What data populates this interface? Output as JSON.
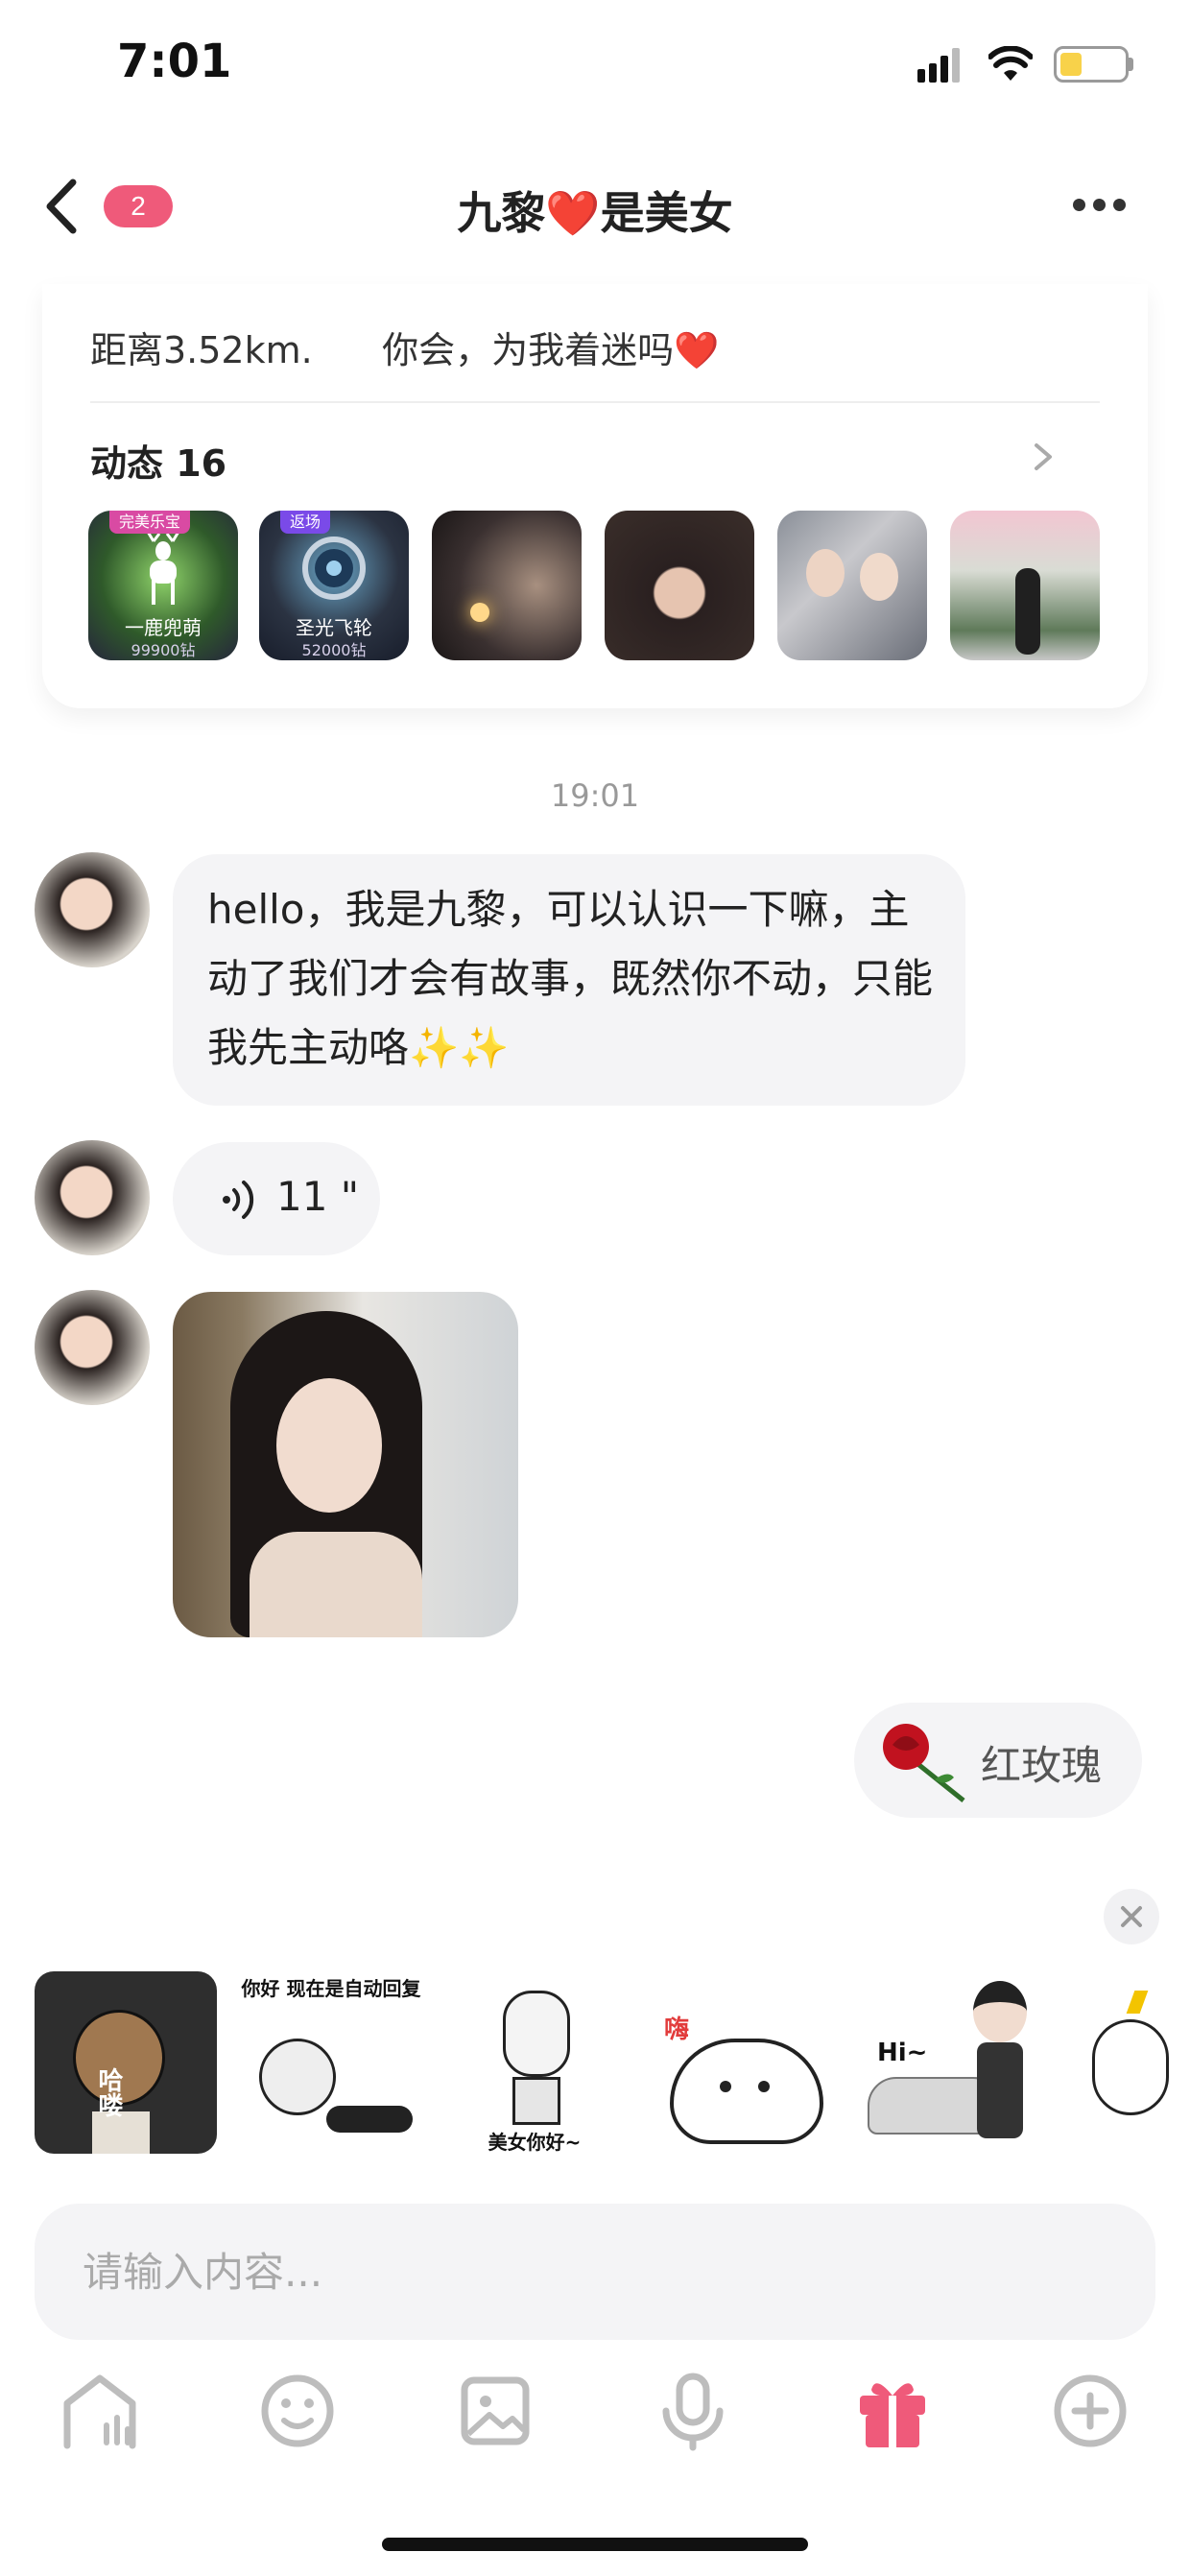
{
  "status_bar": {
    "time": "7:01"
  },
  "nav": {
    "badge": "2",
    "title": "九黎❤️是美女"
  },
  "profile": {
    "distance_line": "距离3.52km.      你会，为我着迷吗❤️",
    "moments_title": "动态 16",
    "thumbs": [
      {
        "tag": "完美乐宝",
        "name": "一鹿兜萌",
        "price": "99900钻"
      },
      {
        "tag": "返场",
        "name": "圣光飞轮",
        "price": "52000钻"
      }
    ]
  },
  "chat": {
    "time": "19:01",
    "messages": [
      {
        "type": "text",
        "text": "hello，我是九黎，可以认识一下嘛，主动了我们才会有故事，既然你不动，只能我先主动咯✨✨"
      },
      {
        "type": "voice",
        "duration": "11 \""
      },
      {
        "type": "image"
      }
    ],
    "gift": {
      "label": "红玫瑰"
    }
  },
  "stickers": [
    {
      "text": "哈喽"
    },
    {
      "text": "你好 现在是自动回复"
    },
    {
      "text": "美女你好~"
    },
    {
      "text": "嗨"
    },
    {
      "text": "Hi~"
    },
    {
      "text": ""
    }
  ],
  "input": {
    "placeholder": "请输入内容..."
  },
  "toolbar": [
    "home-icon",
    "emoji-icon",
    "image-icon",
    "mic-icon",
    "gift-icon",
    "plus-icon"
  ],
  "colors": {
    "accent": "#ef5a7a",
    "bubble": "#f4f4f6"
  }
}
